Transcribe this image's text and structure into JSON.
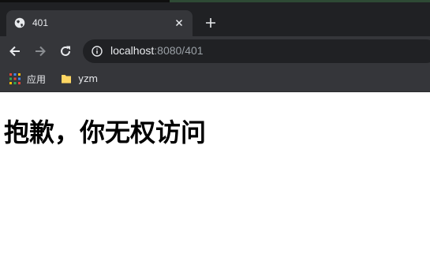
{
  "tab": {
    "title": "401",
    "favicon": "globe-icon",
    "close": "close-icon"
  },
  "toolbar": {
    "new_tab": "plus-icon",
    "back": "back-arrow-icon",
    "forward": "forward-arrow-icon",
    "reload": "reload-icon"
  },
  "address": {
    "host": "localhost",
    "rest": ":8080/401",
    "info": "info-icon"
  },
  "bookmarks": [
    {
      "label": "应用",
      "icon": "apps-grid-icon"
    },
    {
      "label": "yzm",
      "icon": "folder-icon"
    }
  ],
  "page": {
    "heading": "抱歉，你无权访问"
  },
  "colors": {
    "tabstrip": "#202124",
    "toolbar": "#35363a",
    "omnibox": "#202124",
    "text": "#e8eaed",
    "muted": "#9aa0a6"
  }
}
